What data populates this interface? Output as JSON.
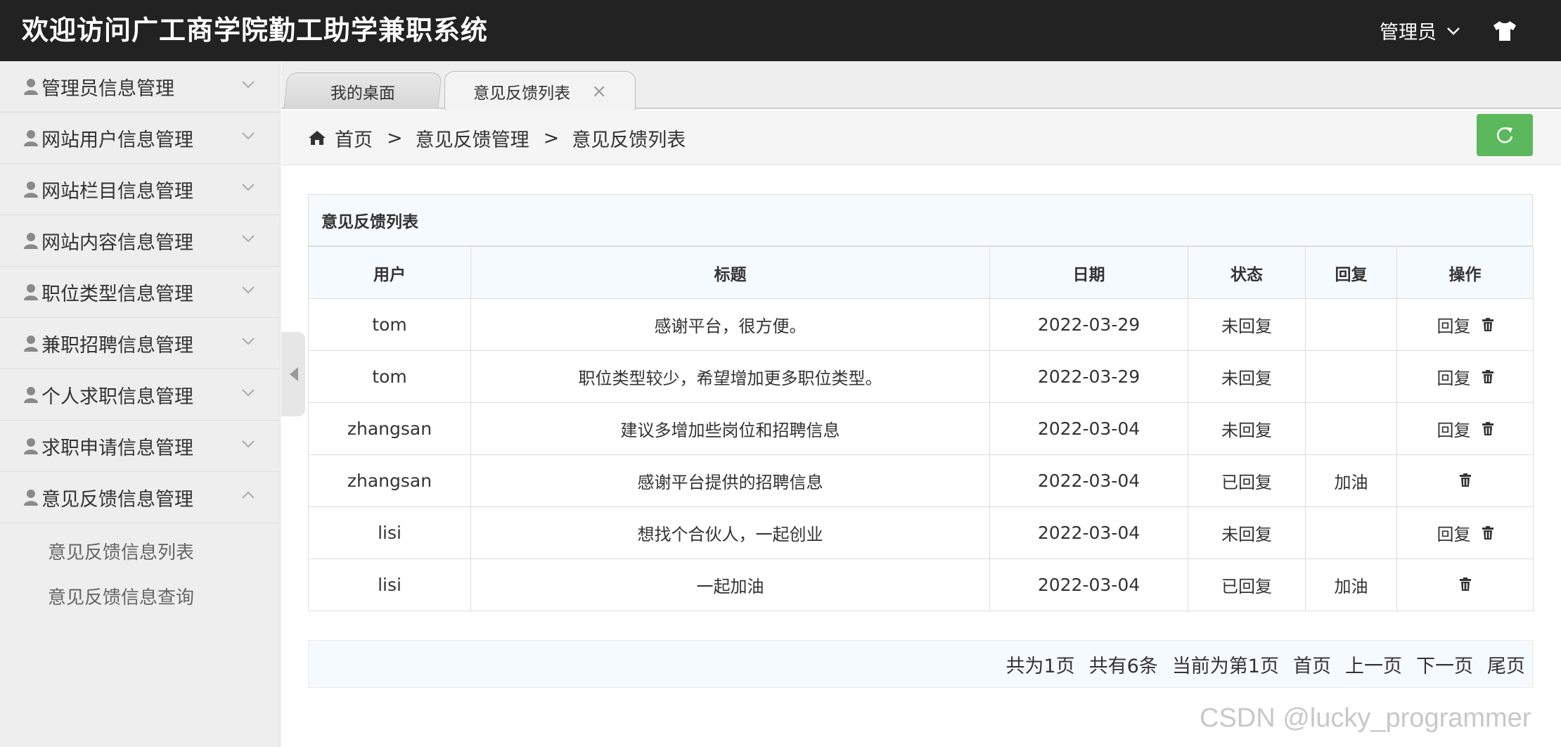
{
  "header": {
    "title": "欢迎访问广工商学院勤工助学兼职系统",
    "user_label": "管理员"
  },
  "sidebar": {
    "items": [
      {
        "label": "管理员信息管理"
      },
      {
        "label": "网站用户信息管理"
      },
      {
        "label": "网站栏目信息管理"
      },
      {
        "label": "网站内容信息管理"
      },
      {
        "label": "职位类型信息管理"
      },
      {
        "label": "兼职招聘信息管理"
      },
      {
        "label": "个人求职信息管理"
      },
      {
        "label": "求职申请信息管理"
      },
      {
        "label": "意见反馈信息管理"
      }
    ],
    "submenu": [
      {
        "label": "意见反馈信息列表"
      },
      {
        "label": "意见反馈信息查询"
      }
    ]
  },
  "tabs": [
    {
      "label": "我的桌面"
    },
    {
      "label": "意见反馈列表",
      "close": "×"
    }
  ],
  "breadcrumb": {
    "home": "首页",
    "sep": ">",
    "level1": "意见反馈管理",
    "level2": "意见反馈列表"
  },
  "table": {
    "caption": "意见反馈列表",
    "headers": [
      "用户",
      "标题",
      "日期",
      "状态",
      "回复",
      "操作"
    ],
    "reply_action": "回复",
    "rows": [
      {
        "user": "tom",
        "title": "感谢平台，很方便。",
        "date": "2022-03-29",
        "status": "未回复",
        "reply": "",
        "can_reply": true
      },
      {
        "user": "tom",
        "title": "职位类型较少，希望增加更多职位类型。",
        "date": "2022-03-29",
        "status": "未回复",
        "reply": "",
        "can_reply": true
      },
      {
        "user": "zhangsan",
        "title": "建议多增加些岗位和招聘信息",
        "date": "2022-03-04",
        "status": "未回复",
        "reply": "",
        "can_reply": true
      },
      {
        "user": "zhangsan",
        "title": "感谢平台提供的招聘信息",
        "date": "2022-03-04",
        "status": "已回复",
        "reply": "加油",
        "can_reply": false
      },
      {
        "user": "lisi",
        "title": "想找个合伙人，一起创业",
        "date": "2022-03-04",
        "status": "未回复",
        "reply": "",
        "can_reply": true
      },
      {
        "user": "lisi",
        "title": "一起加油",
        "date": "2022-03-04",
        "status": "已回复",
        "reply": "加油",
        "can_reply": false
      }
    ]
  },
  "pager": {
    "total_pages": "共为1页",
    "total_items": "共有6条",
    "current": "当前为第1页",
    "first": "首页",
    "prev": "上一页",
    "next": "下一页",
    "last": "尾页"
  },
  "watermark": "CSDN @lucky_programmer",
  "colors": {
    "header_bg": "#222222",
    "sidebar_bg": "#eeeeee",
    "refresh_btn": "#5cb85c",
    "table_header_bg": "#f5faff"
  }
}
